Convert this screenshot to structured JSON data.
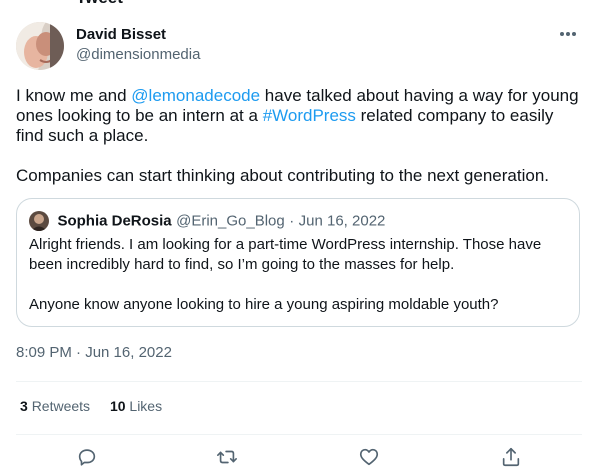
{
  "tweet": {
    "author_name": "David Bisset",
    "author_handle": "@dimensionmedia",
    "text_p1_before": "I know me and ",
    "mention": "@lemonadecode",
    "text_p1_middle": " have talked about having a way for young ones looking to be an intern at a ",
    "hashtag": "#WordPress",
    "text_p1_after": " related company to easily find such a place.",
    "text_p2": "Companies can start thinking about contributing to the next generation.",
    "timestamp": "8:09 PM · Jun 16, 2022",
    "retweets_count": "3",
    "retweets_label": "Retweets",
    "likes_count": "10",
    "likes_label": "Likes"
  },
  "quote": {
    "author_name": "Sophia DeRosia",
    "author_handle": "@Erin_Go_Blog",
    "separator": "·",
    "date": "Jun 16, 2022",
    "text_p1": "Alright friends. I am looking for a part-time WordPress internship. Those have been incredibly hard to find, so I’m going to the masses for help.",
    "text_p2": "Anyone know anyone looking to hire a young aspiring moldable youth?"
  },
  "icons": {
    "more": "more-icon",
    "reply": "reply-icon",
    "retweet": "retweet-icon",
    "like": "like-icon",
    "share": "share-icon"
  },
  "colors": {
    "link": "#1d9bf0",
    "secondary_text": "#536471",
    "border": "#cfd9de"
  }
}
